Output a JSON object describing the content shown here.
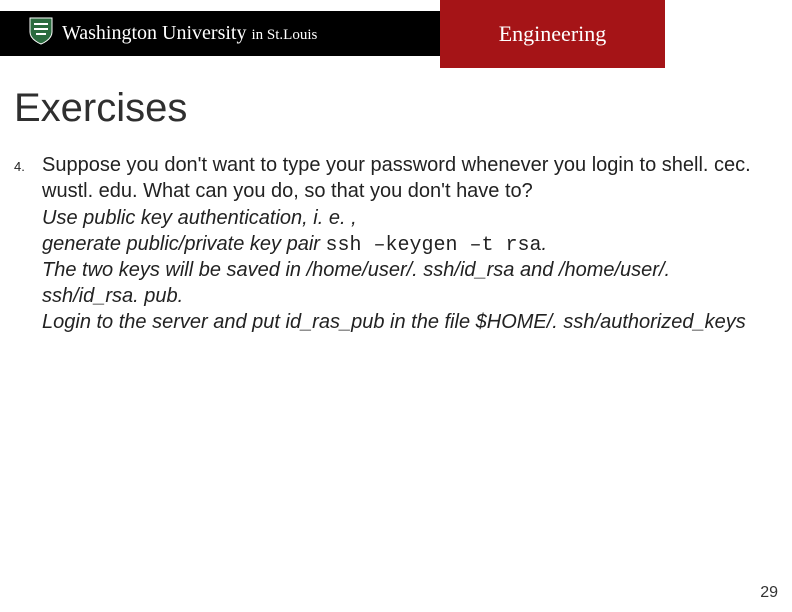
{
  "header": {
    "university_html": "WashingtonUniversity in St.Louis",
    "dept": "Engineering"
  },
  "slide": {
    "title": "Exercises",
    "item_number": "4.",
    "question": "Suppose you don't want to type your password whenever you login to shell. cec. wustl. edu. What can you do, so that you don't have to?",
    "answer_line1": "Use public key authentication, i. e. ,",
    "answer_line2_prefix": "generate public/private key pair ",
    "answer_line2_code": "ssh –keygen –t rsa",
    "answer_line2_suffix": ".",
    "answer_line3": "The two keys will be saved in /home/user/. ssh/id_rsa and /home/user/. ssh/id_rsa. pub.",
    "answer_line4": "Login to the server and put id_ras_pub in the file $HOME/. ssh/authorized_keys"
  },
  "page_number": "29"
}
